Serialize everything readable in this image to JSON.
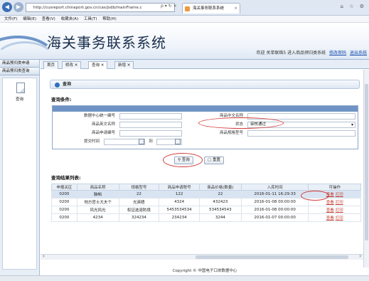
{
  "browser": {
    "url": "http://cusreport.chinaport.gov.cn/cas/jsdb/mainFrame.c",
    "url_icons": "ρ ▾ ↻ ×",
    "tab_title": "海关事务联系系统",
    "win_controls": "⌂ ☆ ⚙"
  },
  "menu": [
    "文件(F)",
    "编辑(E)",
    "查看(V)",
    "收藏夹(A)",
    "工具(T)",
    "帮助(H)"
  ],
  "header": {
    "title": "海关事务联系系统",
    "welcome": "欢迎 关单联络5 进入商品预归类系统",
    "link_password": "修改密码",
    "link_logout": "退出系统"
  },
  "sidebar": {
    "items": [
      "商品预归类申请",
      "商品预归类查询"
    ],
    "panel_label": "查询"
  },
  "tabs": [
    {
      "label": "首页"
    },
    {
      "label": "修改 ✕"
    },
    {
      "label": "查询 ✕"
    },
    {
      "label": "新增 ✕"
    }
  ],
  "panel_title": "查询",
  "search": {
    "section_title": "查询条件:",
    "labels": {
      "data_center_no": "数据中心统一编号",
      "product_cn_name": "商品中文名称",
      "product_en_name": "商品英文名称",
      "status": "状态",
      "apply_no": "商品申请编号",
      "spec_model": "商品规格型号",
      "submit_time": "提交时间",
      "to": "到"
    },
    "status_value": "审核通过",
    "btn_search": "查询",
    "btn_reset": "重置"
  },
  "results": {
    "section_title": "查询结果列表:",
    "columns": [
      "申报关区",
      "商品名称",
      "规格型号",
      "商品申请税号",
      "商品价格(数量)",
      "入库时间",
      "可操作"
    ],
    "rows": [
      [
        "0200",
        "脑帕",
        "22",
        "122",
        "22",
        "2016-01-11 16:29:33",
        "查看",
        "打印"
      ],
      [
        "0200",
        "地方官士大夫个",
        "光英晤",
        "4324",
        "432423",
        "2016-01-08 00:00:00",
        "查看",
        "打印"
      ],
      [
        "0200",
        "风光风光",
        "权证选溶防境",
        "5453534534",
        "534534543",
        "2016-01-08 00:00:00",
        "查看",
        "打印"
      ],
      [
        "0200",
        "4234",
        "324234",
        "234234",
        "3244",
        "2016-01-07 00:00:00",
        "查看",
        "打印"
      ]
    ]
  },
  "footer": "Copyright © 中国电子口岸数据中心",
  "colors": {
    "accent": "#6f93c5",
    "annotation": "#d43a3a",
    "link": "#c0392b"
  }
}
